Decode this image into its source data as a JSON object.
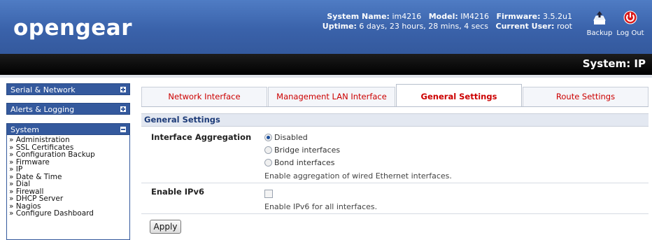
{
  "header": {
    "logo": "opengear",
    "system_name_label": "System Name:",
    "system_name": "im4216",
    "model_label": "Model:",
    "model": "IM4216",
    "firmware_label": "Firmware:",
    "firmware": "3.5.2u1",
    "uptime_label": "Uptime:",
    "uptime": "6 days, 23 hours, 28 mins, 4 secs",
    "current_user_label": "Current User:",
    "current_user": "root",
    "backup_label": "Backup",
    "logout_label": "Log Out",
    "brand_color": "#3a62aa"
  },
  "page_title": "System: IP",
  "sidebar": {
    "sections": [
      {
        "label": "Serial & Network",
        "expanded": false
      },
      {
        "label": "Alerts & Logging",
        "expanded": false
      },
      {
        "label": "System",
        "expanded": true
      }
    ],
    "system_items": [
      "» Administration",
      "» SSL Certificates",
      "» Configuration Backup",
      "» Firmware",
      "» IP",
      "» Date & Time",
      "» Dial",
      "» Firewall",
      "» DHCP Server",
      "» Nagios",
      "» Configure Dashboard"
    ]
  },
  "tabs": [
    {
      "label": "Network Interface",
      "active": false
    },
    {
      "label": "Management LAN Interface",
      "active": false
    },
    {
      "label": "General Settings",
      "active": true
    },
    {
      "label": "Route Settings",
      "active": false
    }
  ],
  "panel": {
    "title": "General Settings",
    "aggregation": {
      "label": "Interface Aggregation",
      "options": [
        "Disabled",
        "Bridge interfaces",
        "Bond interfaces"
      ],
      "selected": "Disabled",
      "hint": "Enable aggregation of wired Ethernet interfaces."
    },
    "ipv6": {
      "label": "Enable IPv6",
      "checked": false,
      "hint": "Enable IPv6 for all interfaces."
    },
    "apply_label": "Apply"
  }
}
